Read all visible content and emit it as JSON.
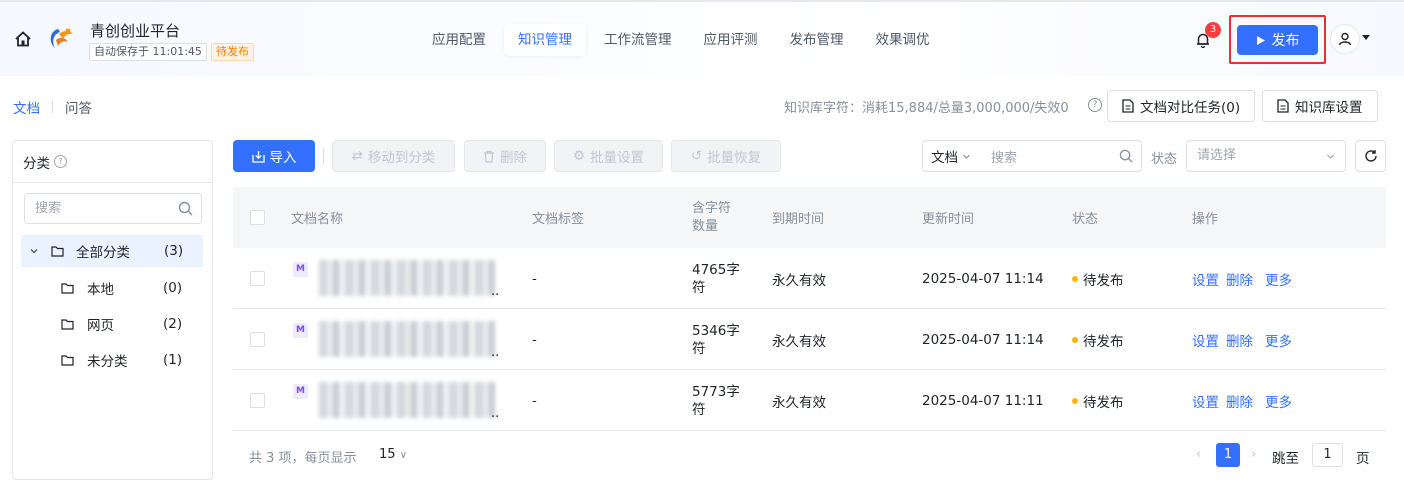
{
  "header": {
    "app_name": "青创创业平台",
    "autosave": "自动保存于 11:01:45",
    "status_badge": "待发布",
    "nav_tabs": [
      "应用配置",
      "知识管理",
      "工作流管理",
      "应用评测",
      "发布管理",
      "效果调优"
    ],
    "active_tab": "知识管理",
    "notification_count": "3",
    "publish_label": "发布"
  },
  "subheader": {
    "tabs": [
      "文档",
      "问答"
    ],
    "kb_usage": "知识库字符：消耗15,884/总量3,000,000/失效0",
    "compare_task_label": "文档对比任务(0)",
    "kb_settings_label": "知识库设置"
  },
  "sidebar": {
    "title": "分类",
    "search_placeholder": "搜索",
    "root": {
      "label": "全部分类",
      "count": "(3)"
    },
    "items": [
      {
        "label": "本地",
        "count": "(0)"
      },
      {
        "label": "网页",
        "count": "(2)"
      },
      {
        "label": "未分类",
        "count": "(1)"
      }
    ]
  },
  "toolbar": {
    "import_label": "导入",
    "move_label": "移动到分类",
    "delete_label": "删除",
    "batch_settings_label": "批量设置",
    "batch_restore_label": "批量恢复",
    "doc_type": "文档",
    "search_placeholder": "搜索",
    "status_label": "状态",
    "status_placeholder": "请选择"
  },
  "table": {
    "columns": [
      "文档名称",
      "文档标签",
      "含字符\n数量",
      "到期时间",
      "更新时间",
      "状态",
      "操作"
    ],
    "rows": [
      {
        "tag": "-",
        "chars": "4765字\n符",
        "expire": "永久有效",
        "updated": "2025-04-07 11:14",
        "status": "待发布"
      },
      {
        "tag": "-",
        "chars": "5346字\n符",
        "expire": "永久有效",
        "updated": "2025-04-07 11:14",
        "status": "待发布"
      },
      {
        "tag": "-",
        "chars": "5773字\n符",
        "expire": "永久有效",
        "updated": "2025-04-07 11:11",
        "status": "待发布"
      }
    ],
    "ops": [
      "设置",
      "删除",
      "更多"
    ]
  },
  "footer": {
    "total_text": "共 3 项，每页显示",
    "page_size": "15",
    "current_page": "1",
    "jump_label": "跳至",
    "jump_value": "1",
    "page_unit": "页"
  },
  "colors": {
    "primary": "#3370ff",
    "pending": "#ffb400",
    "highlight_outline": "#e8302f"
  }
}
